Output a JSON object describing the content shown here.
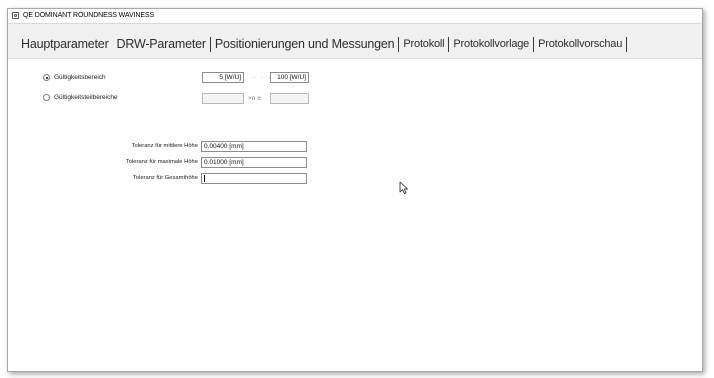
{
  "window": {
    "title": "QE DOMINANT ROUNDNESS WAVINESS"
  },
  "tabs": [
    {
      "label": "Hauptparameter"
    },
    {
      "label": "DRW-Parameter"
    },
    {
      "label": "Positionierungen und Messungen"
    },
    {
      "label": "Protokoll"
    },
    {
      "label": "Protokollvorlage"
    },
    {
      "label": "Protokollvorschau"
    }
  ],
  "ranges": {
    "option1": {
      "label": "Gültigkeitsbereich",
      "checked": true
    },
    "option2": {
      "label": "Gültigkeitsteilbereiche",
      "checked": false
    },
    "from_value": "5 [W/U]",
    "separator": ". . .",
    "to_value": "100 [W/U]",
    "n_plus_minus": "×n ±"
  },
  "tolerances": [
    {
      "label": "Toleranz für mittlere Höhe",
      "value": "0.00400 [mm]"
    },
    {
      "label": "Toleranz für maximale Höhe",
      "value": "0.01000 [mm]"
    },
    {
      "label": "Toleranz für Gesamthöhe",
      "value": ""
    }
  ],
  "cursor": {
    "icon": "mouse-pointer-icon"
  }
}
